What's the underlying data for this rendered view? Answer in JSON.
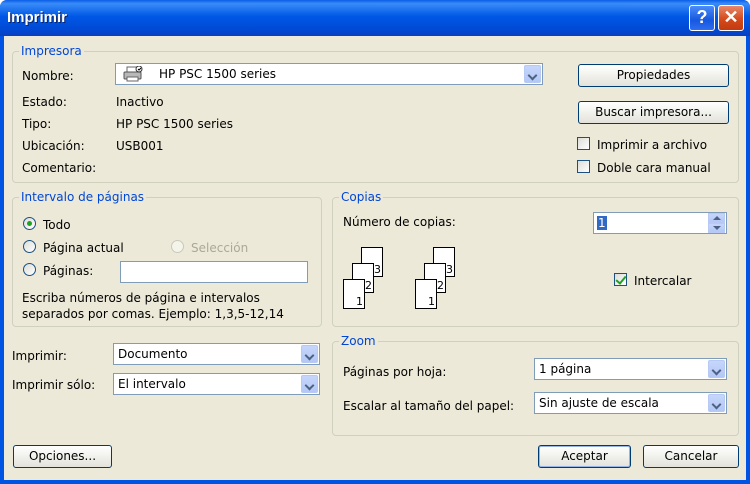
{
  "window": {
    "title": "Imprimir"
  },
  "printer": {
    "group_title": "Impresora",
    "name_label": "Nombre:",
    "name_value": "HP PSC 1500 series",
    "status_label": "Estado:",
    "status_value": "Inactivo",
    "type_label": "Tipo:",
    "type_value": "HP PSC 1500 series",
    "location_label": "Ubicación:",
    "location_value": "USB001",
    "comment_label": "Comentario:",
    "properties_button": "Propiedades",
    "find_printer_button": "Buscar impresora...",
    "print_to_file_label": "Imprimir a archivo",
    "print_to_file_checked": false,
    "manual_duplex_label": "Doble cara manual",
    "manual_duplex_checked": false
  },
  "page_range": {
    "group_title": "Intervalo de páginas",
    "all_label": "Todo",
    "current_page_label": "Página actual",
    "selection_label": "Selección",
    "pages_label": "Páginas:",
    "pages_value": "",
    "selected": "Todo",
    "help_line1": "Escriba números de página e intervalos",
    "help_line2": "separados por comas. Ejemplo: 1,3,5-12,14"
  },
  "copies": {
    "group_title": "Copias",
    "number_label": "Número de copias:",
    "number_value": "1",
    "collate_label": "Intercalar",
    "collate_checked": true,
    "stack_pages": [
      "1",
      "2",
      "3"
    ]
  },
  "print_what": {
    "label": "Imprimir:",
    "value": "Documento"
  },
  "print_only": {
    "label": "Imprimir sólo:",
    "value": "El intervalo"
  },
  "zoom": {
    "group_title": "Zoom",
    "pages_per_sheet_label": "Páginas por hoja:",
    "pages_per_sheet_value": "1 página",
    "scale_label": "Escalar al tamaño del papel:",
    "scale_value": "Sin ajuste de escala"
  },
  "footer": {
    "options_button": "Opciones...",
    "ok_button": "Aceptar",
    "cancel_button": "Cancelar"
  }
}
